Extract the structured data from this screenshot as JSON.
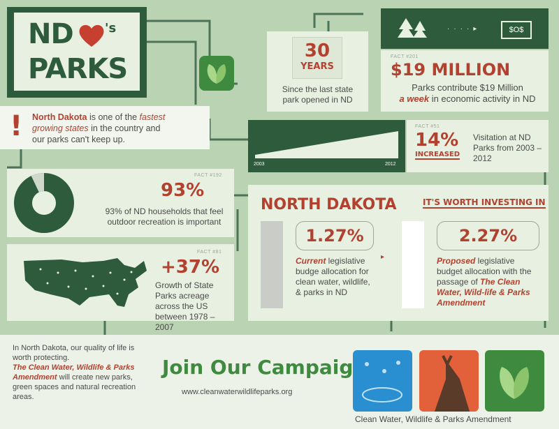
{
  "logo": {
    "nd": "ND",
    "s": "'s",
    "parks": "PARKS"
  },
  "intro": {
    "bold": "North Dakota",
    "t1": " is one of the ",
    "em1": "fastest",
    "em2": "growing states",
    "t2": " in the country and",
    "t3": "our parks can't keep up.",
    "bang": "!"
  },
  "years": {
    "num": "30",
    "unit": "YEARS",
    "text": "Since the last state park opened in ND"
  },
  "money": {
    "fact": "FACT #201",
    "big": "$19 MILLION",
    "text1": "Parks contribute $19 Million",
    "em": "a week",
    "text2": " in economic activity in ND",
    "bill": "$O$"
  },
  "visit": {
    "fact": "FACT #51",
    "pct": "14%",
    "inc": "INCREASED",
    "text": "Visitation at ND Parks from 2003 – 2012",
    "y1": "2003",
    "y2": "2012"
  },
  "households": {
    "fact": "FACT #192",
    "pct": "93%",
    "text": "93% of ND households that feel outdoor recreation is important",
    "value": 0.93
  },
  "acreage": {
    "fact": "FACT #81",
    "pct": "+37%",
    "text": "Growth of State Parks acreage across the US between 1978 – 2007"
  },
  "invest": {
    "title": "NORTH DAKOTA",
    "sub": "IT'S WORTH INVESTING IN",
    "cur": {
      "pct": "1.27%",
      "em": "Current",
      "text": " legislative budge allocation for clean water, wildlife, & parks in ND"
    },
    "prop": {
      "pct": "2.27%",
      "em": "Proposed",
      "text": " legislative budget allocation with the passage of ",
      "em2": "The Clean Water, Wild-life & Parks Amendment"
    }
  },
  "footer": {
    "p1": "In North Dakota, our quality of life is worth protecting.",
    "em": "The Clean Water, Wildlife & Parks Amendment",
    "p2": " will create new parks, green spaces and natural recreation areas.",
    "join": "Join Our Campaign",
    "url": "www.cleanwaterwildlifeparks.org",
    "amend": "Clean Water, Wildlife & Parks Amendment"
  }
}
